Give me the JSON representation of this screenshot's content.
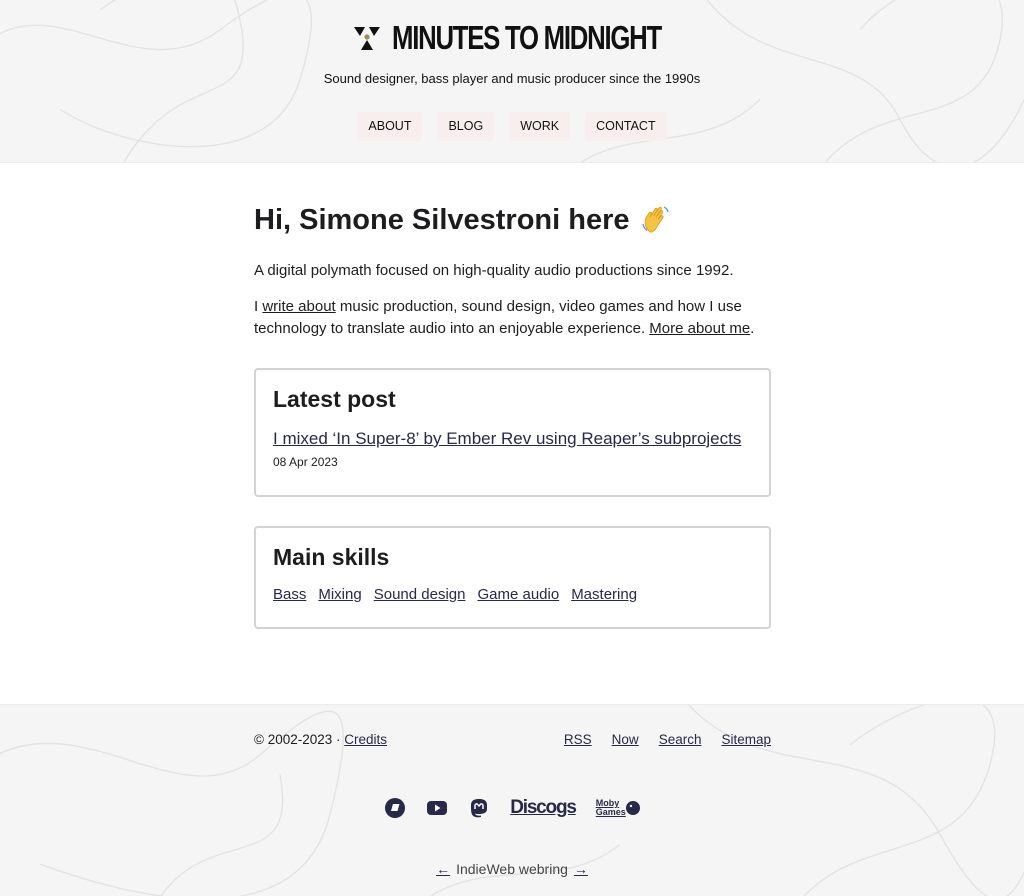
{
  "header": {
    "site_title": "MINUTES TO MIDNIGHT",
    "tagline": "Sound designer, bass player and music producer since the 1990s",
    "nav": [
      {
        "label": "ABOUT"
      },
      {
        "label": "BLOG"
      },
      {
        "label": "WORK"
      },
      {
        "label": "CONTACT"
      }
    ]
  },
  "main": {
    "greeting": "Hi, Simone Silvestroni here",
    "intro": "A digital polymath focused on high-quality audio productions since 1992.",
    "bio": {
      "prefix": "I ",
      "write_about_link": "write about",
      "middle": " music production, sound design, video games and how I use technology to translate audio into an enjoyable experience. ",
      "more_link": "More about me",
      "suffix": "."
    },
    "latest_post": {
      "heading": "Latest post",
      "title": "I mixed ‘In Super-8’ by Ember Rev using Reaper’s subprojects",
      "date": "08 Apr 2023"
    },
    "skills": {
      "heading": "Main skills",
      "items": [
        "Bass",
        "Mixing",
        "Sound design",
        "Game audio",
        "Mastering"
      ]
    }
  },
  "footer": {
    "copyright": "© 2002-2023 · ",
    "credits_link": "Credits",
    "links": [
      "RSS",
      "Now",
      "Search",
      "Sitemap"
    ],
    "socials": {
      "discogs": "Discogs",
      "moby_top": "Moby",
      "moby_bottom": "Games"
    },
    "webring": {
      "prev": "←",
      "label": "IndieWeb webring",
      "next": "→"
    }
  },
  "colors": {
    "link": "#27294a",
    "nav_bg": "#f9eeee",
    "card_border": "#d3d3d3",
    "band_bg": "#f5f5f5"
  },
  "icons": [
    "radiation-logo-icon",
    "waving-hand-icon",
    "bluesky-icon",
    "youtube-icon",
    "mastodon-icon",
    "discogs-icon",
    "mobygames-icon"
  ]
}
